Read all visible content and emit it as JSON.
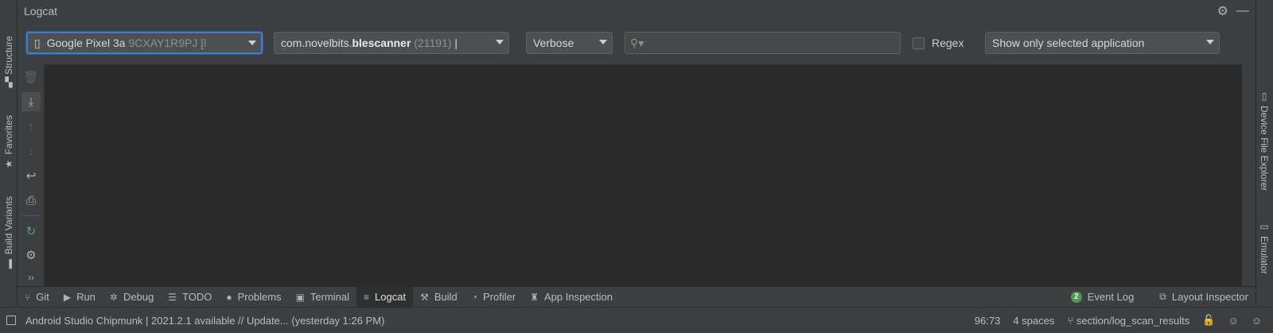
{
  "window": {
    "title": "Logcat"
  },
  "left_tabs": [
    {
      "label": "Structure",
      "icon": "structure-icon"
    },
    {
      "label": "Favorites",
      "icon": "star-icon"
    },
    {
      "label": "Build Variants",
      "icon": "android-icon"
    }
  ],
  "right_tabs": [
    {
      "label": "Device File Explorer",
      "icon": "phone-icon"
    },
    {
      "label": "Emulator",
      "icon": "emulator-icon"
    }
  ],
  "filters": {
    "device_name": "Google Pixel 3a",
    "device_serial": "9CXAY1R9PJ [",
    "device_suffix": "l",
    "process_prefix": "com.novelbits.",
    "process_bold": "blescanner",
    "process_pid": "(21191)",
    "process_sep": "|",
    "log_level": "Verbose",
    "search_value": "",
    "regex_label": "Regex",
    "scope": "Show only selected application"
  },
  "tool_tabs": [
    {
      "label": "Git",
      "icon": "git-icon"
    },
    {
      "label": "Run",
      "icon": "run-icon"
    },
    {
      "label": "Debug",
      "icon": "bug-icon"
    },
    {
      "label": "TODO",
      "icon": "list-icon"
    },
    {
      "label": "Problems",
      "icon": "problems-icon"
    },
    {
      "label": "Terminal",
      "icon": "terminal-icon"
    },
    {
      "label": "Logcat",
      "icon": "logcat-icon",
      "selected": true
    },
    {
      "label": "Build",
      "icon": "hammer-icon"
    },
    {
      "label": "Profiler",
      "icon": "gauge-icon"
    },
    {
      "label": "App Inspection",
      "icon": "inspect-icon"
    }
  ],
  "tool_tabs_right": {
    "event_log": "Event Log",
    "event_count": "2",
    "layout_inspector": "Layout Inspector"
  },
  "status": {
    "message": "Android Studio Chipmunk | 2021.2.1 available // Update... (yesterday 1:26 PM)",
    "position": "96:73",
    "indent": "4 spaces",
    "branch": "section/log_scan_results"
  },
  "colors": {
    "accent": "#3d7ec9",
    "log_bg": "#2b2b2b",
    "panel_bg": "#3c3f41",
    "badge_green": "#499c54"
  }
}
